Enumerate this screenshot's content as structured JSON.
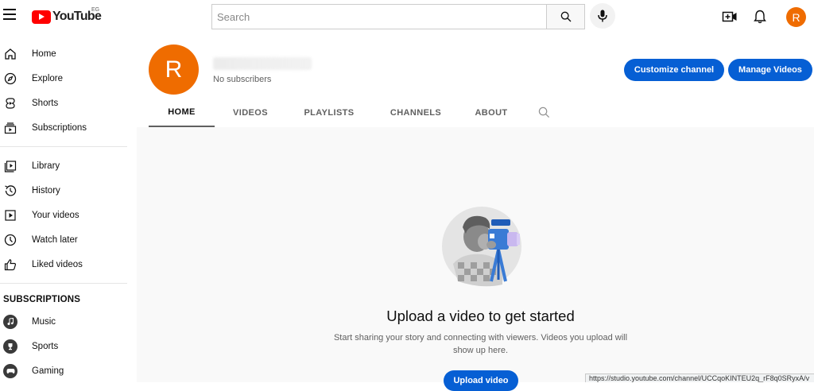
{
  "header": {
    "logo_text": "YouTube",
    "country_code": "EG",
    "search_placeholder": "Search",
    "avatar_letter": "R"
  },
  "sidebar": {
    "primary": [
      {
        "label": "Home",
        "icon": "home-icon"
      },
      {
        "label": "Explore",
        "icon": "explore-icon"
      },
      {
        "label": "Shorts",
        "icon": "shorts-icon"
      },
      {
        "label": "Subscriptions",
        "icon": "subscriptions-icon"
      }
    ],
    "library": [
      {
        "label": "Library",
        "icon": "library-icon"
      },
      {
        "label": "History",
        "icon": "history-icon"
      },
      {
        "label": "Your videos",
        "icon": "your-videos-icon"
      },
      {
        "label": "Watch later",
        "icon": "watch-later-icon"
      },
      {
        "label": "Liked videos",
        "icon": "liked-videos-icon"
      }
    ],
    "subscriptions_heading": "SUBSCRIPTIONS",
    "subscriptions": [
      {
        "label": "Music",
        "icon": "music-icon"
      },
      {
        "label": "Sports",
        "icon": "sports-icon"
      },
      {
        "label": "Gaming",
        "icon": "gaming-icon"
      }
    ]
  },
  "channel": {
    "avatar_letter": "R",
    "subscribers": "No subscribers",
    "customize_label": "Customize channel",
    "manage_label": "Manage Videos",
    "tabs": [
      "HOME",
      "VIDEOS",
      "PLAYLISTS",
      "CHANNELS",
      "ABOUT"
    ],
    "active_tab": "HOME"
  },
  "empty_state": {
    "title": "Upload a video to get started",
    "description": "Start sharing your story and connecting with viewers. Videos you upload will show up here.",
    "upload_label": "Upload video"
  },
  "status_bar": {
    "url": "https://studio.youtube.com/channel/UCCqoKINTEU2q_rF8q0SRyxA/v"
  },
  "colors": {
    "brand_red": "#ff0000",
    "accent_blue": "#065fd4",
    "avatar_orange": "#ef6c00"
  }
}
